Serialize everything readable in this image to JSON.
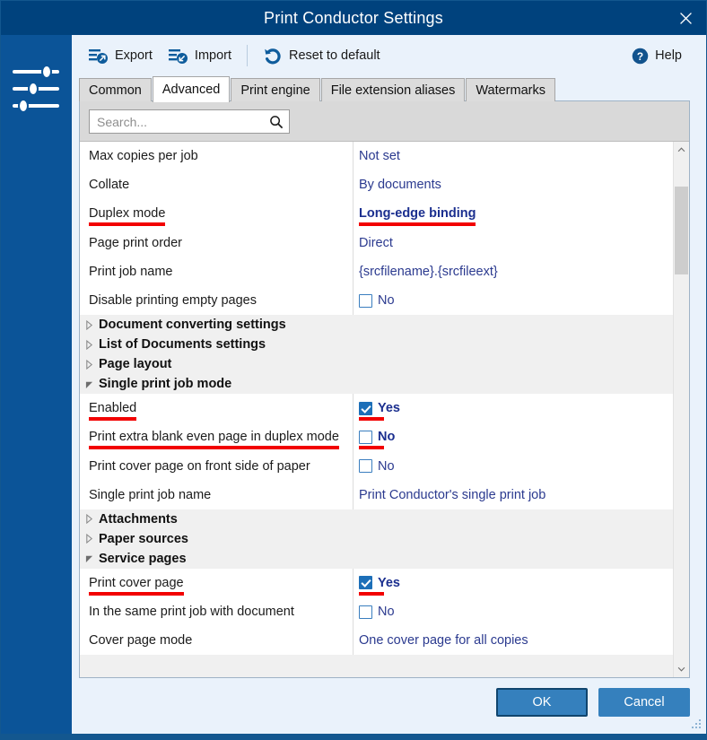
{
  "window": {
    "title": "Print Conductor Settings",
    "close_label": "×",
    "sidebar_icon": "sliders-icon"
  },
  "toolbar": {
    "items": [
      {
        "label": "Export",
        "icon": "export-icon"
      },
      {
        "label": "Import",
        "icon": "import-icon"
      },
      {
        "label": "Reset to default",
        "icon": "reset-icon"
      }
    ],
    "help": {
      "label": "Help",
      "icon": "help-icon"
    }
  },
  "tabs": [
    {
      "label": "Common",
      "active": false
    },
    {
      "label": "Advanced",
      "active": true
    },
    {
      "label": "Print engine",
      "active": false
    },
    {
      "label": "File extension aliases",
      "active": false
    },
    {
      "label": "Watermarks",
      "active": false
    }
  ],
  "search": {
    "placeholder": "Search...",
    "value": "",
    "icon": "search-icon"
  },
  "settings": {
    "rows": [
      {
        "label": "Max copies per job",
        "value": "Not set"
      },
      {
        "label": "Collate",
        "value": "By documents"
      },
      {
        "label": "Duplex mode",
        "value": "Long-edge binding"
      },
      {
        "label": "Page print order",
        "value": "Direct"
      },
      {
        "label": "Print job name",
        "value": "{srcfilename}.{srcfileext}"
      },
      {
        "label": "Disable printing empty pages",
        "value": "No"
      }
    ],
    "groups": [
      {
        "title": "Document converting settings",
        "expanded": false
      },
      {
        "title": "List of Documents settings",
        "expanded": false
      },
      {
        "title": "Page layout",
        "expanded": false
      },
      {
        "title": "Single print job mode",
        "expanded": true
      }
    ],
    "single_print_job_rows": [
      {
        "label": "Enabled",
        "value": "Yes"
      },
      {
        "label": "Print extra blank even page in duplex mode",
        "value": "No"
      },
      {
        "label": "Print cover page on front side of paper",
        "value": "No"
      },
      {
        "label": "Single print job name",
        "value": "Print Conductor's single print job"
      }
    ],
    "groups2": [
      {
        "title": "Attachments",
        "expanded": false
      },
      {
        "title": "Paper sources",
        "expanded": false
      },
      {
        "title": "Service pages",
        "expanded": true
      }
    ],
    "service_pages_rows": [
      {
        "label": "Print cover page",
        "value": "Yes"
      },
      {
        "label": "In the same print job with document",
        "value": "No"
      },
      {
        "label": "Cover page mode",
        "value": "One cover page for all copies"
      }
    ]
  },
  "footer": {
    "ok_label": "OK",
    "cancel_label": "Cancel"
  },
  "colors": {
    "titlebar": "#00427d",
    "sidebar": "#0b5498",
    "accent": "#3580bd",
    "value_text": "#2b3a8f",
    "highlight_underline": "#f20000",
    "checkbox_checked": "#1d6fb8"
  }
}
